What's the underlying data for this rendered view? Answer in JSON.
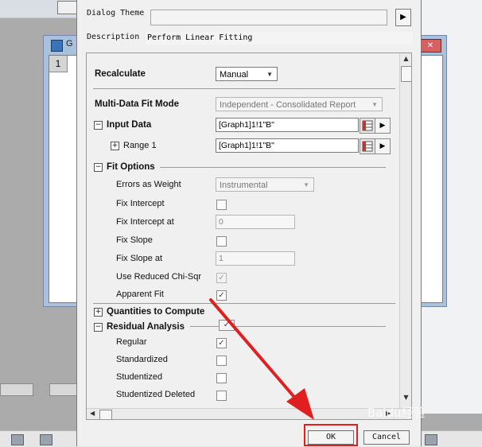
{
  "background_app": {
    "window_title": "G",
    "row_number": "1"
  },
  "dialog": {
    "theme_label": "Dialog Theme",
    "theme_value": "",
    "theme_arrow": "▶",
    "description_label": "Description",
    "description_value": "Perform Linear Fitting",
    "recalculate": {
      "label": "Recalculate",
      "value": "Manual"
    },
    "multi_data_fit_mode": {
      "label": "Multi-Data Fit Mode",
      "value": "Independent - Consolidated Report"
    },
    "input_data": {
      "toggle": "−",
      "label": "Input Data",
      "value": "[Graph1]1!1\"B\"",
      "range1": {
        "toggle": "+",
        "label": "Range 1",
        "value": "[Graph1]1!1\"B\""
      }
    },
    "fit_options": {
      "toggle": "−",
      "label": "Fit Options",
      "errors_as_weight": {
        "label": "Errors as Weight",
        "value": "Instrumental"
      },
      "fix_intercept": {
        "label": "Fix Intercept",
        "checked": false
      },
      "fix_intercept_at": {
        "label": "Fix Intercept at",
        "value": "0"
      },
      "fix_slope": {
        "label": "Fix Slope",
        "checked": false
      },
      "fix_slope_at": {
        "label": "Fix Slope at",
        "value": "1"
      },
      "use_reduced_chisqr": {
        "label": "Use Reduced Chi-Sqr",
        "checked": true
      },
      "apparent_fit": {
        "label": "Apparent Fit",
        "checked": true
      }
    },
    "quantities_to_compute": {
      "toggle": "+",
      "label": "Quantities to Compute"
    },
    "residual_analysis": {
      "toggle": "−",
      "label": "Residual Analysis",
      "header_checked": true,
      "regular": {
        "label": "Regular",
        "checked": true
      },
      "standardized": {
        "label": "Standardized",
        "checked": false
      },
      "studentized": {
        "label": "Studentized",
        "checked": false
      },
      "studentized_deleted": {
        "label": "Studentized Deleted",
        "checked": false
      }
    },
    "ok_label": "OK",
    "cancel_label": "Cancel"
  },
  "check_glyph": "✓",
  "dropdown_glyph": "▼",
  "range_arrow_glyph": "▶",
  "colors": {
    "annotation_red": "#e02020",
    "dialog_bg": "#f0f0f0",
    "background_window": "#a9c1dc"
  },
  "watermark": "Baidu经验"
}
